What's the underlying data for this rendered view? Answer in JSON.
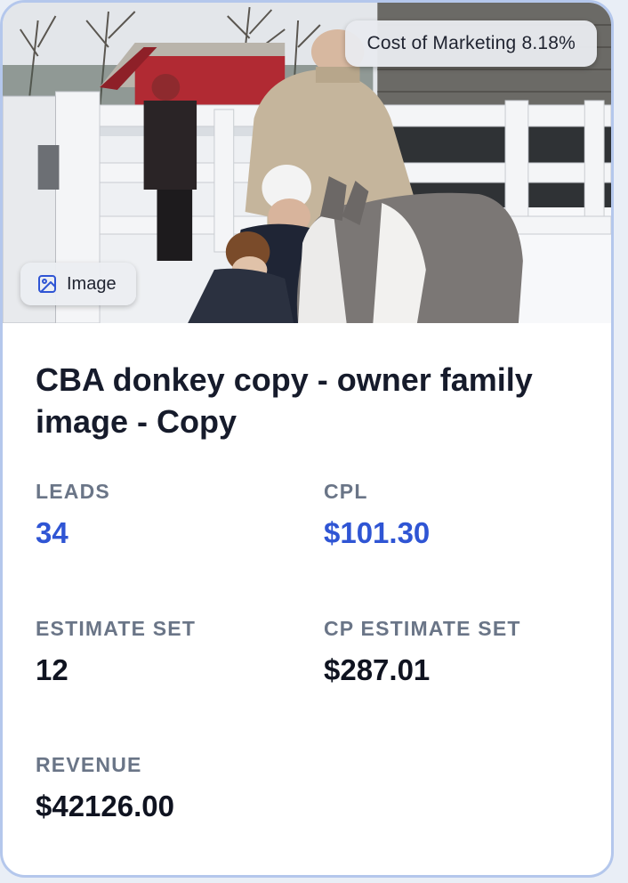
{
  "card": {
    "media": {
      "kind": "photo",
      "marketing_badge": "Cost of Marketing 8.18%",
      "type_badge_label": "Image",
      "type_badge_icon": "image-icon"
    },
    "title": "CBA donkey copy - owner family image - Copy",
    "stats": {
      "leads": {
        "label": "LEADS",
        "value": "34"
      },
      "cpl": {
        "label": "CPL",
        "value": "$101.30"
      },
      "estimate_set": {
        "label": "ESTIMATE SET",
        "value": "12"
      },
      "cp_estimate_set": {
        "label": "CP ESTIMATE SET",
        "value": "$287.01"
      },
      "revenue": {
        "label": "REVENUE",
        "value": "$42126.00"
      }
    }
  },
  "colors": {
    "card_border": "#b4c7ec",
    "accent_value": "#2f55d4",
    "label": "#6a7587",
    "title": "#161b2b"
  }
}
